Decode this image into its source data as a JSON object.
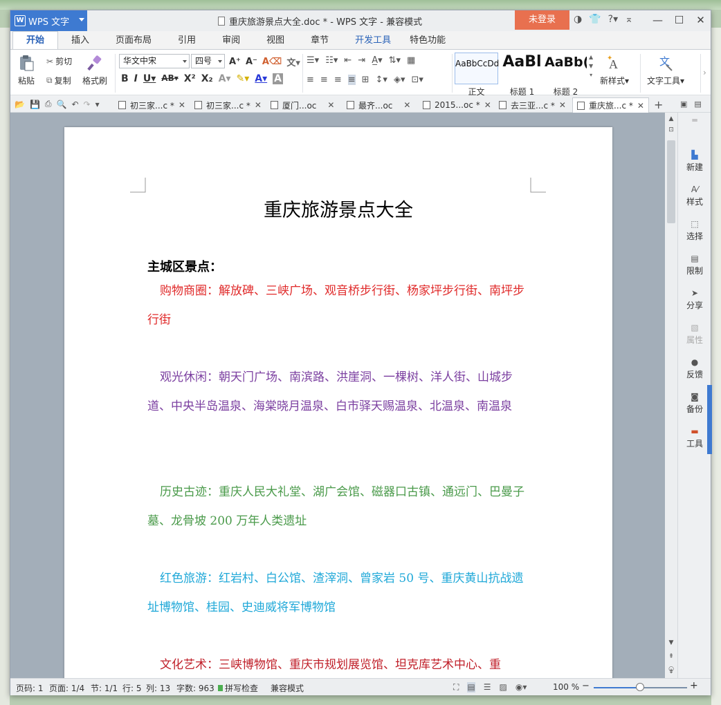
{
  "titlebar": {
    "app_label": "WPS 文字",
    "window_title": "重庆旅游景点大全.doc * - WPS 文字 - 兼容模式",
    "login_label": "未登录",
    "help_label": "?"
  },
  "menu_tabs": [
    "开始",
    "插入",
    "页面布局",
    "引用",
    "审阅",
    "视图",
    "章节",
    "开发工具",
    "特色功能"
  ],
  "ribbon": {
    "paste_label": "粘贴",
    "cut_label": "剪切",
    "copy_label": "复制",
    "format_painter_label": "格式刷",
    "font_name": "华文中宋",
    "font_size": "四号",
    "styles": [
      {
        "preview": "AaBbCcDd",
        "label": "正文"
      },
      {
        "preview": "AaBl",
        "label": "标题 1"
      },
      {
        "preview": "AaBb(",
        "label": "标题 2"
      }
    ],
    "new_style_label": "新样式",
    "text_tools_label": "文字工具"
  },
  "doc_tabs": [
    {
      "title": "初三家...c *"
    },
    {
      "title": "初三家...c *"
    },
    {
      "title": "厦门...oc"
    },
    {
      "title": "最齐...oc"
    },
    {
      "title": "2015...oc *"
    },
    {
      "title": "去三亚...c *"
    },
    {
      "title": "重庆旅...c *"
    }
  ],
  "document": {
    "title": "重庆旅游景点大全",
    "section_heading": "主城区景点：",
    "paragraphs": [
      {
        "text": "购物商圈：解放碑、三峡广场、观音桥步行街、杨家坪步行街、南坪步行街",
        "color": "#e02a2a"
      },
      {
        "text": "观光休闲：朝天门广场、南滨路、洪崖洞、一棵树、洋人街、山城步道、中央半岛温泉、海棠晓月温泉、白市驿天赐温泉、北温泉、南温泉",
        "color": "#7b3fa0"
      },
      {
        "text": "历史古迹：重庆人民大礼堂、湖广会馆、磁器口古镇、通远门、巴曼子墓、龙骨坡 200 万年人类遗址",
        "color": "#4a9a4a"
      },
      {
        "text": "红色旅游：红岩村、白公馆、渣滓洞、曾家岩 50 号、重庆黄山抗战遗址博物馆、桂园、史迪威将军博物馆",
        "color": "#1fa8d8"
      },
      {
        "text": "文化艺术：三峡博物馆、重庆市规划展览馆、坦克库艺术中心、重",
        "color": "#c0202a"
      }
    ]
  },
  "right_panel": [
    "新建",
    "样式",
    "选择",
    "限制",
    "分享",
    "属性",
    "反馈",
    "备份",
    "工具"
  ],
  "status_bar": {
    "page_code": "页码: 1",
    "page": "页面: 1/4",
    "section": "节: 1/1",
    "row": "行: 5",
    "column": "列: 13",
    "word_count": "字数: 963",
    "spell_check": "拼写检查",
    "mode": "兼容模式",
    "zoom": "100 %"
  },
  "colors": {
    "accent": "#3e7ad1",
    "login": "#e8704f"
  }
}
